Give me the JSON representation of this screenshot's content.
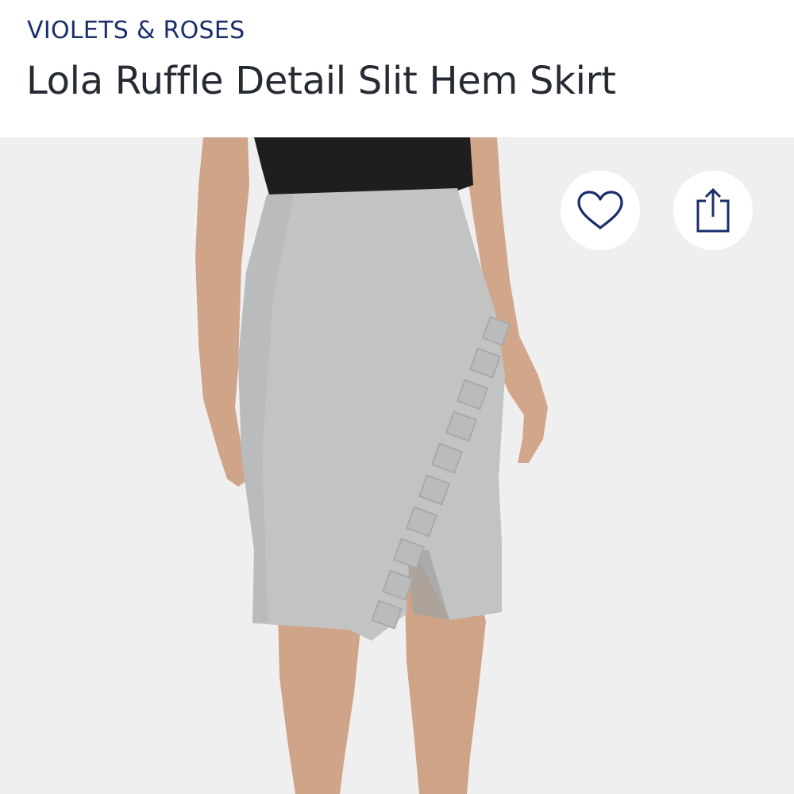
{
  "product": {
    "brand": "VIOLETS & ROSES",
    "title": "Lola Ruffle Detail Slit Hem Skirt",
    "image": "product-photo-skirt"
  },
  "actions": {
    "wishlist_icon": "heart-icon",
    "share_icon": "share-icon"
  },
  "colors": {
    "brand": "#1b2e6b",
    "title": "#262a33",
    "icon": "#1b2e6b",
    "photo_bg": "#efeff0"
  }
}
